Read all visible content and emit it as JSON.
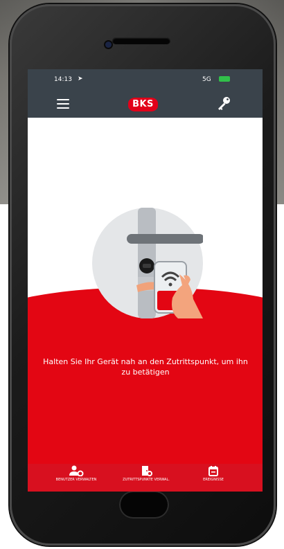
{
  "status_bar": {
    "time": "14:13",
    "location_icon": "location-arrow-icon",
    "network": "5G",
    "battery_icon": "battery-icon"
  },
  "app_bar": {
    "menu_icon": "hamburger-menu-icon",
    "logo_text": "BKS",
    "key_icon": "key-icon"
  },
  "main": {
    "illustration": "hand-holding-phone-at-door-lock-illustration",
    "message": "Halten Sie Ihr Gerät nah an den Zutrittspunkt, um ihn zu betätigen"
  },
  "tab_bar": {
    "items": [
      {
        "label": "BENUTZER VERWALTEN",
        "icon": "user-gear-icon"
      },
      {
        "label": "ZUTRITTSPUNKTE VERWAL.",
        "icon": "door-gear-icon"
      },
      {
        "label": "EREIGNISSE",
        "icon": "calendar-icon"
      }
    ]
  },
  "colors": {
    "accent_red": "#e30613",
    "header_gray": "#3a434b",
    "battery_green": "#31c04a"
  }
}
